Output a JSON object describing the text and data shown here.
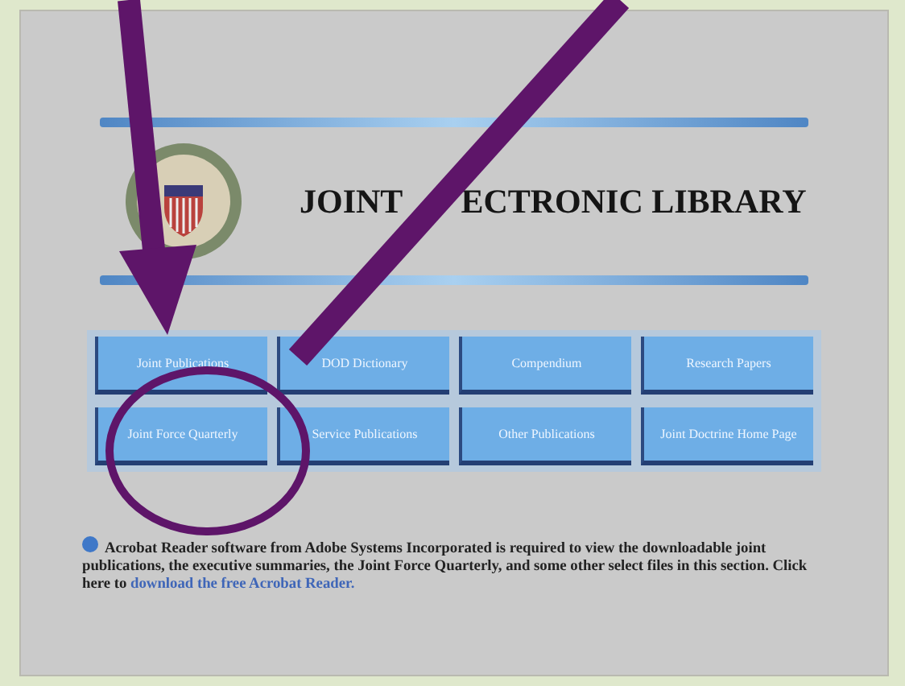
{
  "header": {
    "title_parts": [
      "JOINT",
      "ECTRONIC LIBRARY"
    ]
  },
  "buttons": [
    "Joint Publications",
    "DOD Dictionary",
    "Compendium",
    "Research Papers",
    "Joint Force Quarterly",
    "Service Publications",
    "Other Publications",
    "Joint Doctrine Home Page"
  ],
  "notice": {
    "text": "Acrobat Reader software from Adobe Systems Incorporated is required to view the downloadable joint publications, the executive summaries, the Joint Force Quarterly, and some other select files in this section.  Click here to",
    "link": "download the free Acrobat Reader."
  }
}
